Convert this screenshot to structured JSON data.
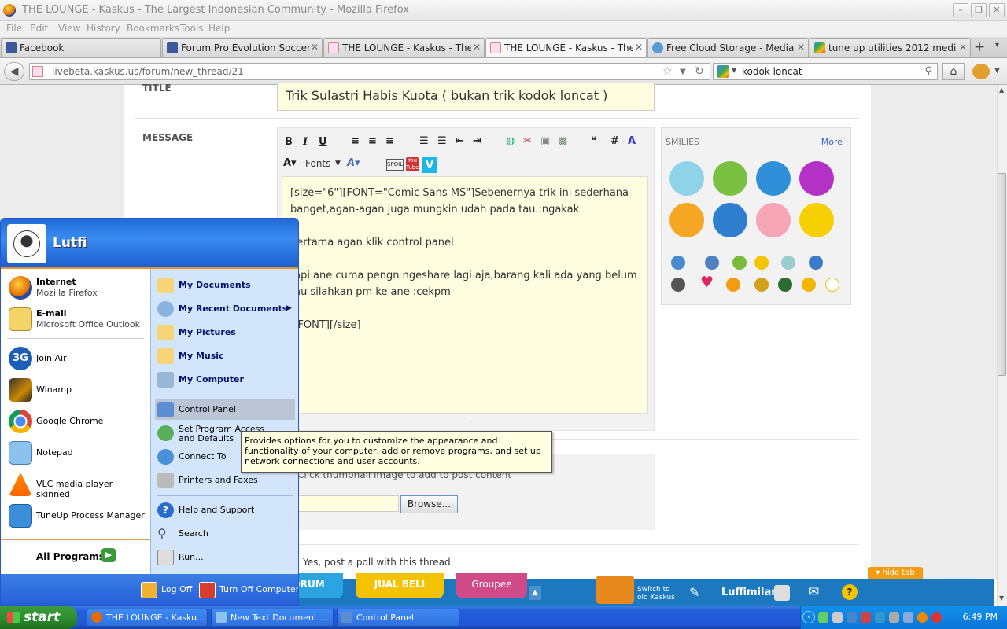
{
  "window": {
    "title": "THE LOUNGE - Kaskus - The Largest Indonesian Community - Mozilla Firefox"
  },
  "menu": [
    "File",
    "Edit",
    "View",
    "History",
    "Bookmarks",
    "Tools",
    "Help"
  ],
  "tabs": [
    {
      "label": "Facebook"
    },
    {
      "label": "Forum Pro Evolution Soccer 6"
    },
    {
      "label": "THE LOUNGE - Kaskus - The Lar..."
    },
    {
      "label": "THE LOUNGE - Kaskus - The Lar..."
    },
    {
      "label": "Free Cloud Storage - MediaFire"
    },
    {
      "label": "tune up utilities 2012 mediafire ..."
    }
  ],
  "nav": {
    "url": "livebeta.kaskus.us/forum/new_thread/21",
    "search": "kodok loncat"
  },
  "form": {
    "title_label": "TITLE",
    "title_value": "Trik Sulastri Habis Kuota ( bukan trik kodok loncat )",
    "message_label": "MESSAGE",
    "fonts_label": "Fonts",
    "message_lines": [
      "[size=\"6\"][FONT=\"Comic Sans MS\"]Sebenernya trik ini sederhana",
      "banget,agan-agan juga mungkin udah pada tau.:ngakak",
      "",
      "pertama agan klik control panel",
      "",
      "tapi ane cuma pengn ngeshare lagi aja,barang kali ada yang belum",
      "tau silahkan pm ke ane :cekpm",
      "",
      "[/FONT][/size]"
    ],
    "attach_hint": "Click thumbnail image to add to post content",
    "browse": "Browse...",
    "poll": "Yes, post a poll with this thread"
  },
  "smilies": {
    "title": "SMILIES",
    "more": "More"
  },
  "kaskus_bar": {
    "forum": "FORUM",
    "jualbeli": "JUAL BELI",
    "groupee": "Groupee",
    "switch": "Switch to old Kaskus",
    "user": "Luffimilan",
    "hide_tab": "hide tab"
  },
  "start_menu": {
    "user": "Lutfi",
    "pinned": [
      {
        "name": "Internet",
        "sub": "Mozilla Firefox"
      },
      {
        "name": "E-mail",
        "sub": "Microsoft Office Outlook"
      }
    ],
    "recent": [
      "Join Air",
      "Winamp",
      "Google Chrome",
      "Notepad",
      "VLC media player skinned",
      "TuneUp Process Manager"
    ],
    "all_programs": "All Programs",
    "places": [
      "My Documents",
      "My Recent Documents",
      "My Pictures",
      "My Music",
      "My Computer"
    ],
    "settings": [
      "Control Panel",
      "Set Program Access and Defaults",
      "Connect To",
      "Printers and Faxes"
    ],
    "help": [
      "Help and Support",
      "Search",
      "Run..."
    ],
    "log_off": "Log Off",
    "turn_off": "Turn Off Computer"
  },
  "tooltip": "Provides options for you to customize the appearance and functionality of your computer, add or remove programs, and set up network connections and user accounts.",
  "taskbar": {
    "start": "start",
    "items": [
      "THE LOUNGE - Kasku...",
      "New Text Document....",
      "Control Panel"
    ],
    "clock": "6:49 PM"
  }
}
